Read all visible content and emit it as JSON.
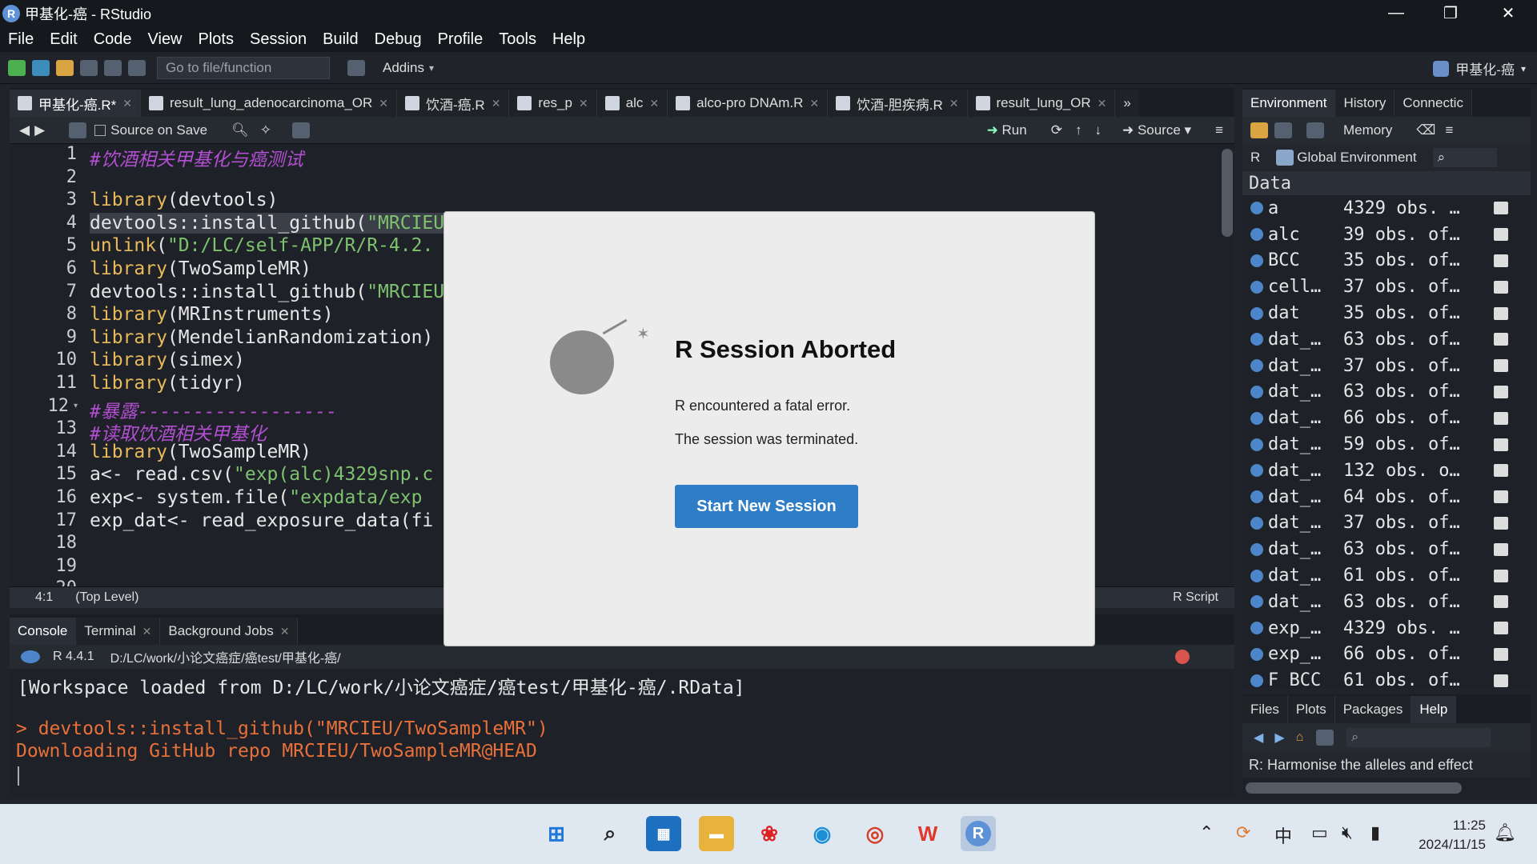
{
  "window": {
    "title": "甲基化-癌 - RStudio",
    "minimize": "—",
    "restore": "❐",
    "close": "✕"
  },
  "menu": [
    "File",
    "Edit",
    "Code",
    "View",
    "Plots",
    "Session",
    "Build",
    "Debug",
    "Profile",
    "Tools",
    "Help"
  ],
  "toolbar": {
    "goto_placeholder": "Go to file/function",
    "addins": "Addins",
    "project": "甲基化-癌"
  },
  "editor": {
    "tabs": [
      "甲基化-癌.R*",
      "result_lung_adenocarcinoma_OR",
      "饮酒-癌.R",
      "res_p",
      "alc",
      "alco-pro DNAm.R",
      "饮酒-胆疾病.R",
      "result_lung_OR"
    ],
    "source_on_save": "Source on Save",
    "run": "Run",
    "source": "Source",
    "line_numbers": [
      "1",
      "2",
      "3",
      "4",
      "5",
      "6",
      "7",
      "8",
      "9",
      "10",
      "11",
      "12",
      "13",
      "14",
      "15",
      "16",
      "17",
      "18",
      "19",
      "20"
    ],
    "status_pos": "4:1",
    "status_scope": "(Top Level)",
    "status_type": "R Script"
  },
  "console": {
    "tabs": [
      "Console",
      "Terminal",
      "Background Jobs"
    ],
    "r_version": "R 4.4.1",
    "path": "D:/LC/work/小论文癌症/癌test/甲基化-癌/",
    "line1": "[Workspace loaded from D:/LC/work/小论文癌症/癌test/甲基化-癌/.RData]",
    "line2": "> devtools::install_github(\"MRCIEU/TwoSampleMR\")",
    "line3": "Downloading GitHub repo MRCIEU/TwoSampleMR@HEAD"
  },
  "environment": {
    "tabs": [
      "Environment",
      "History",
      "Connectic"
    ],
    "memory": "Memory",
    "lang": "R",
    "scope": "Global Environment",
    "header": "Data",
    "rows": [
      {
        "name": "a",
        "value": "4329 obs. …"
      },
      {
        "name": "alc",
        "value": "39 obs. of…"
      },
      {
        "name": "BCC",
        "value": "35 obs. of…"
      },
      {
        "name": "cell…",
        "value": "37 obs. of…"
      },
      {
        "name": "dat",
        "value": "35 obs. of…"
      },
      {
        "name": "dat_…",
        "value": "63 obs. of…"
      },
      {
        "name": "dat_…",
        "value": "37 obs. of…"
      },
      {
        "name": "dat_…",
        "value": "63 obs. of…"
      },
      {
        "name": "dat_…",
        "value": "66 obs. of…"
      },
      {
        "name": "dat_…",
        "value": "59 obs. of…"
      },
      {
        "name": "dat_…",
        "value": "132 obs. o…"
      },
      {
        "name": "dat_…",
        "value": "64 obs. of…"
      },
      {
        "name": "dat_…",
        "value": "37 obs. of…"
      },
      {
        "name": "dat_…",
        "value": "63 obs. of…"
      },
      {
        "name": "dat_…",
        "value": "61 obs. of…"
      },
      {
        "name": "dat_…",
        "value": "63 obs. of…"
      },
      {
        "name": "exp_…",
        "value": "4329 obs. …"
      },
      {
        "name": "exp_…",
        "value": "66 obs. of…"
      },
      {
        "name": "F_BCC",
        "value": "61 obs. of…"
      }
    ]
  },
  "files": {
    "tabs": [
      "Files",
      "Plots",
      "Packages",
      "Help"
    ],
    "help_topic": "R: Harmonise the alleles and effect"
  },
  "modal": {
    "title": "R Session Aborted",
    "message1": "R encountered a fatal error.",
    "message2": "The session was terminated.",
    "button": "Start New Session"
  },
  "taskbar": {
    "ime": "中",
    "time": "11:25",
    "date": "2024/11/15"
  }
}
